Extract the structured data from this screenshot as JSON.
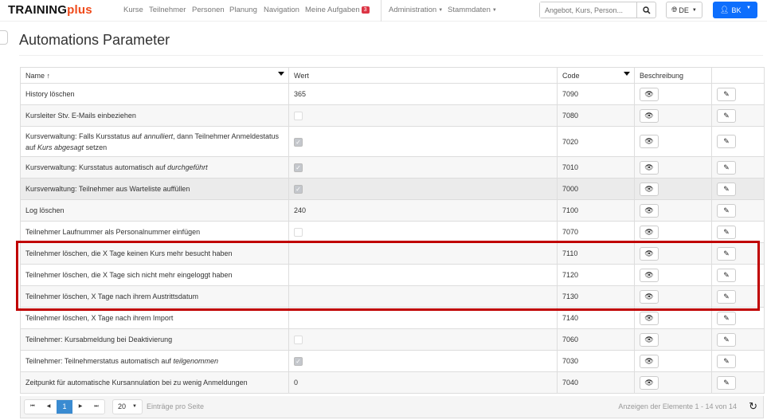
{
  "brand": {
    "main": "TRAINING",
    "accent": "plus"
  },
  "nav": {
    "items": [
      "Kurse",
      "Teilnehmer",
      "Personen",
      "Planung",
      "Navigation",
      "Meine Aufgaben"
    ],
    "tasks_badge": "3",
    "admin": "Administration",
    "stammdaten": "Stammdaten"
  },
  "search": {
    "placeholder": "Angebot, Kurs, Person..."
  },
  "lang": "DE",
  "user": "BK",
  "page_title": "Automations Parameter",
  "table": {
    "headers": {
      "name": "Name",
      "sort": "↑",
      "wert": "Wert",
      "code": "Code",
      "beschreibung": "Beschreibung"
    },
    "rows": [
      {
        "name": [
          {
            "t": "History löschen"
          }
        ],
        "wert": "365",
        "code": "7090"
      },
      {
        "name": [
          {
            "t": "Kursleiter Stv. E-Mails einbeziehen"
          }
        ],
        "check": false,
        "code": "7080"
      },
      {
        "name": [
          {
            "t": "Kursverwaltung: Falls Kursstatus auf "
          },
          {
            "t": "annulliert",
            "i": true
          },
          {
            "t": ", dann Teilnehmer Anmeldestatus auf "
          },
          {
            "t": "Kurs abgesagt",
            "i": true
          },
          {
            "t": " setzen"
          }
        ],
        "check": true,
        "code": "7020",
        "tall": true
      },
      {
        "name": [
          {
            "t": "Kursverwaltung: Kursstatus automatisch auf "
          },
          {
            "t": "durchgeführt",
            "i": true
          }
        ],
        "check": true,
        "code": "7010"
      },
      {
        "name": [
          {
            "t": "Kursverwaltung: Teilnehmer aus Warteliste auffüllen"
          }
        ],
        "check": true,
        "code": "7000",
        "hover": true
      },
      {
        "name": [
          {
            "t": "Log löschen"
          }
        ],
        "wert": "240",
        "code": "7100"
      },
      {
        "name": [
          {
            "t": "Teilnehmer Laufnummer als Personalnummer einfügen"
          }
        ],
        "check": false,
        "code": "7070"
      },
      {
        "name": [
          {
            "t": "Teilnehmer löschen, die X Tage keinen Kurs mehr besucht haben"
          }
        ],
        "wert": "",
        "code": "7110"
      },
      {
        "name": [
          {
            "t": "Teilnehmer löschen, die X Tage sich nicht mehr eingeloggt haben"
          }
        ],
        "wert": "",
        "code": "7120"
      },
      {
        "name": [
          {
            "t": "Teilnehmer löschen, X Tage nach ihrem Austrittsdatum"
          }
        ],
        "wert": "",
        "code": "7130"
      },
      {
        "name": [
          {
            "t": "Teilnehmer löschen, X Tage nach ihrem Import"
          }
        ],
        "wert": "",
        "code": "7140"
      },
      {
        "name": [
          {
            "t": "Teilnehmer: Kursabmeldung bei Deaktivierung"
          }
        ],
        "check": false,
        "code": "7060"
      },
      {
        "name": [
          {
            "t": "Teilnehmer: Teilnehmerstatus automatisch auf "
          },
          {
            "t": "teilgenommen",
            "i": true
          }
        ],
        "check": true,
        "code": "7030"
      },
      {
        "name": [
          {
            "t": "Zeitpunkt für automatische Kursannulation bei zu wenig Anmeldungen"
          }
        ],
        "wert": "0",
        "code": "7040"
      }
    ]
  },
  "pager": {
    "current": "1",
    "page_size": "20",
    "page_size_label": "Einträge pro Seite",
    "info": "Anzeigen der Elemente 1 - 14 von 14"
  },
  "colors": {
    "accent": "#f04a1a",
    "primary": "#0d6efd",
    "highlight": "#c00000",
    "badge": "#dc3545"
  }
}
